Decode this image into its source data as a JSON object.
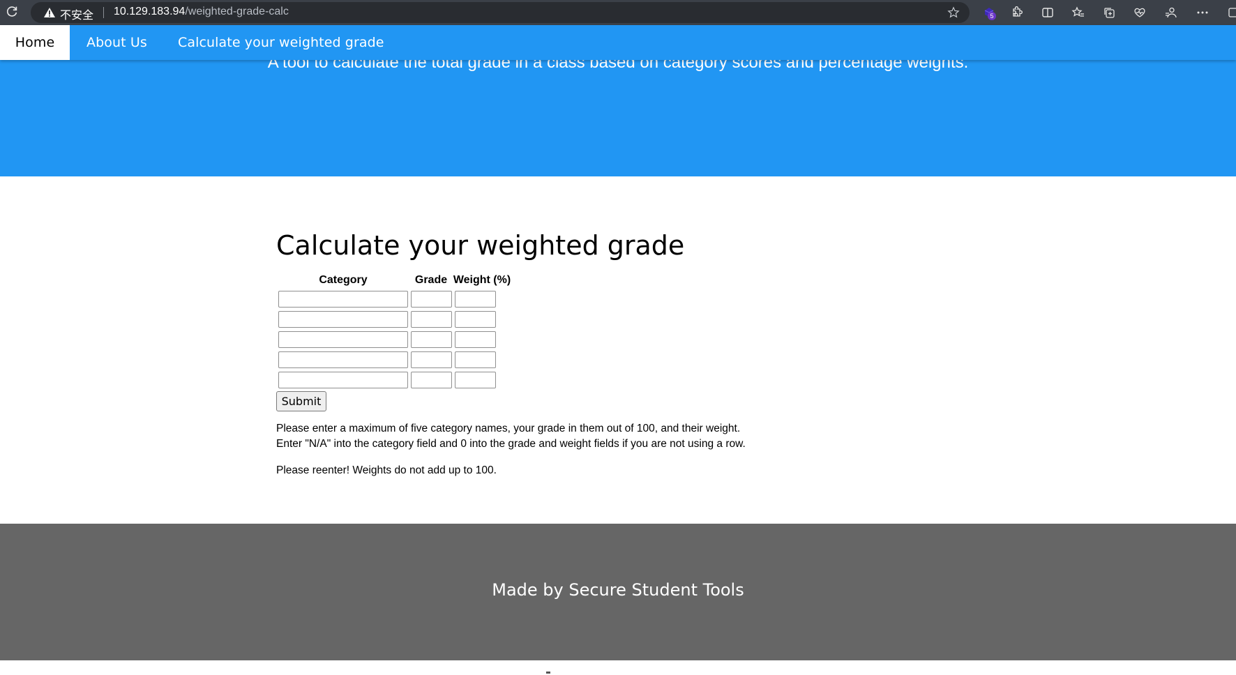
{
  "browser": {
    "security_label": "不安全",
    "url_host": "10.129.183.94",
    "url_path": "/weighted-grade-calc",
    "extension_badge": "5",
    "icons": [
      "reload-icon",
      "warning-icon",
      "star-icon",
      "extension-icon",
      "puzzle-icon",
      "split-screen-icon",
      "favorites-icon",
      "collections-icon",
      "browser-essentials-icon",
      "profile-icon",
      "more-icon"
    ]
  },
  "nav": {
    "items": [
      {
        "label": "Home",
        "active": true
      },
      {
        "label": "About Us",
        "active": false
      },
      {
        "label": "Calculate your weighted grade",
        "active": false
      }
    ]
  },
  "hero": {
    "subtitle": "A tool to calculate the total grade in a class based on category scores and percentage weights."
  },
  "main": {
    "title": "Calculate your weighted grade",
    "table": {
      "headers": [
        "Category",
        "Grade",
        "Weight (%)"
      ],
      "rows": [
        {
          "category": "",
          "grade": "",
          "weight": ""
        },
        {
          "category": "",
          "grade": "",
          "weight": ""
        },
        {
          "category": "",
          "grade": "",
          "weight": ""
        },
        {
          "category": "",
          "grade": "",
          "weight": ""
        },
        {
          "category": "",
          "grade": "",
          "weight": ""
        }
      ]
    },
    "submit_label": "Submit",
    "instructions_line1": "Please enter a maximum of five category names, your grade in them out of 100, and their weight.",
    "instructions_line2": "Enter \"N/A\" into the category field and 0 into the grade and weight fields if you are not using a row.",
    "error_message": "Please reenter! Weights do not add up to 100."
  },
  "footer": {
    "text": "Made by Secure Student Tools"
  },
  "colors": {
    "nav_blue": "#2196f3",
    "footer_gray": "#666666",
    "browser_bar": "#3b4048"
  }
}
